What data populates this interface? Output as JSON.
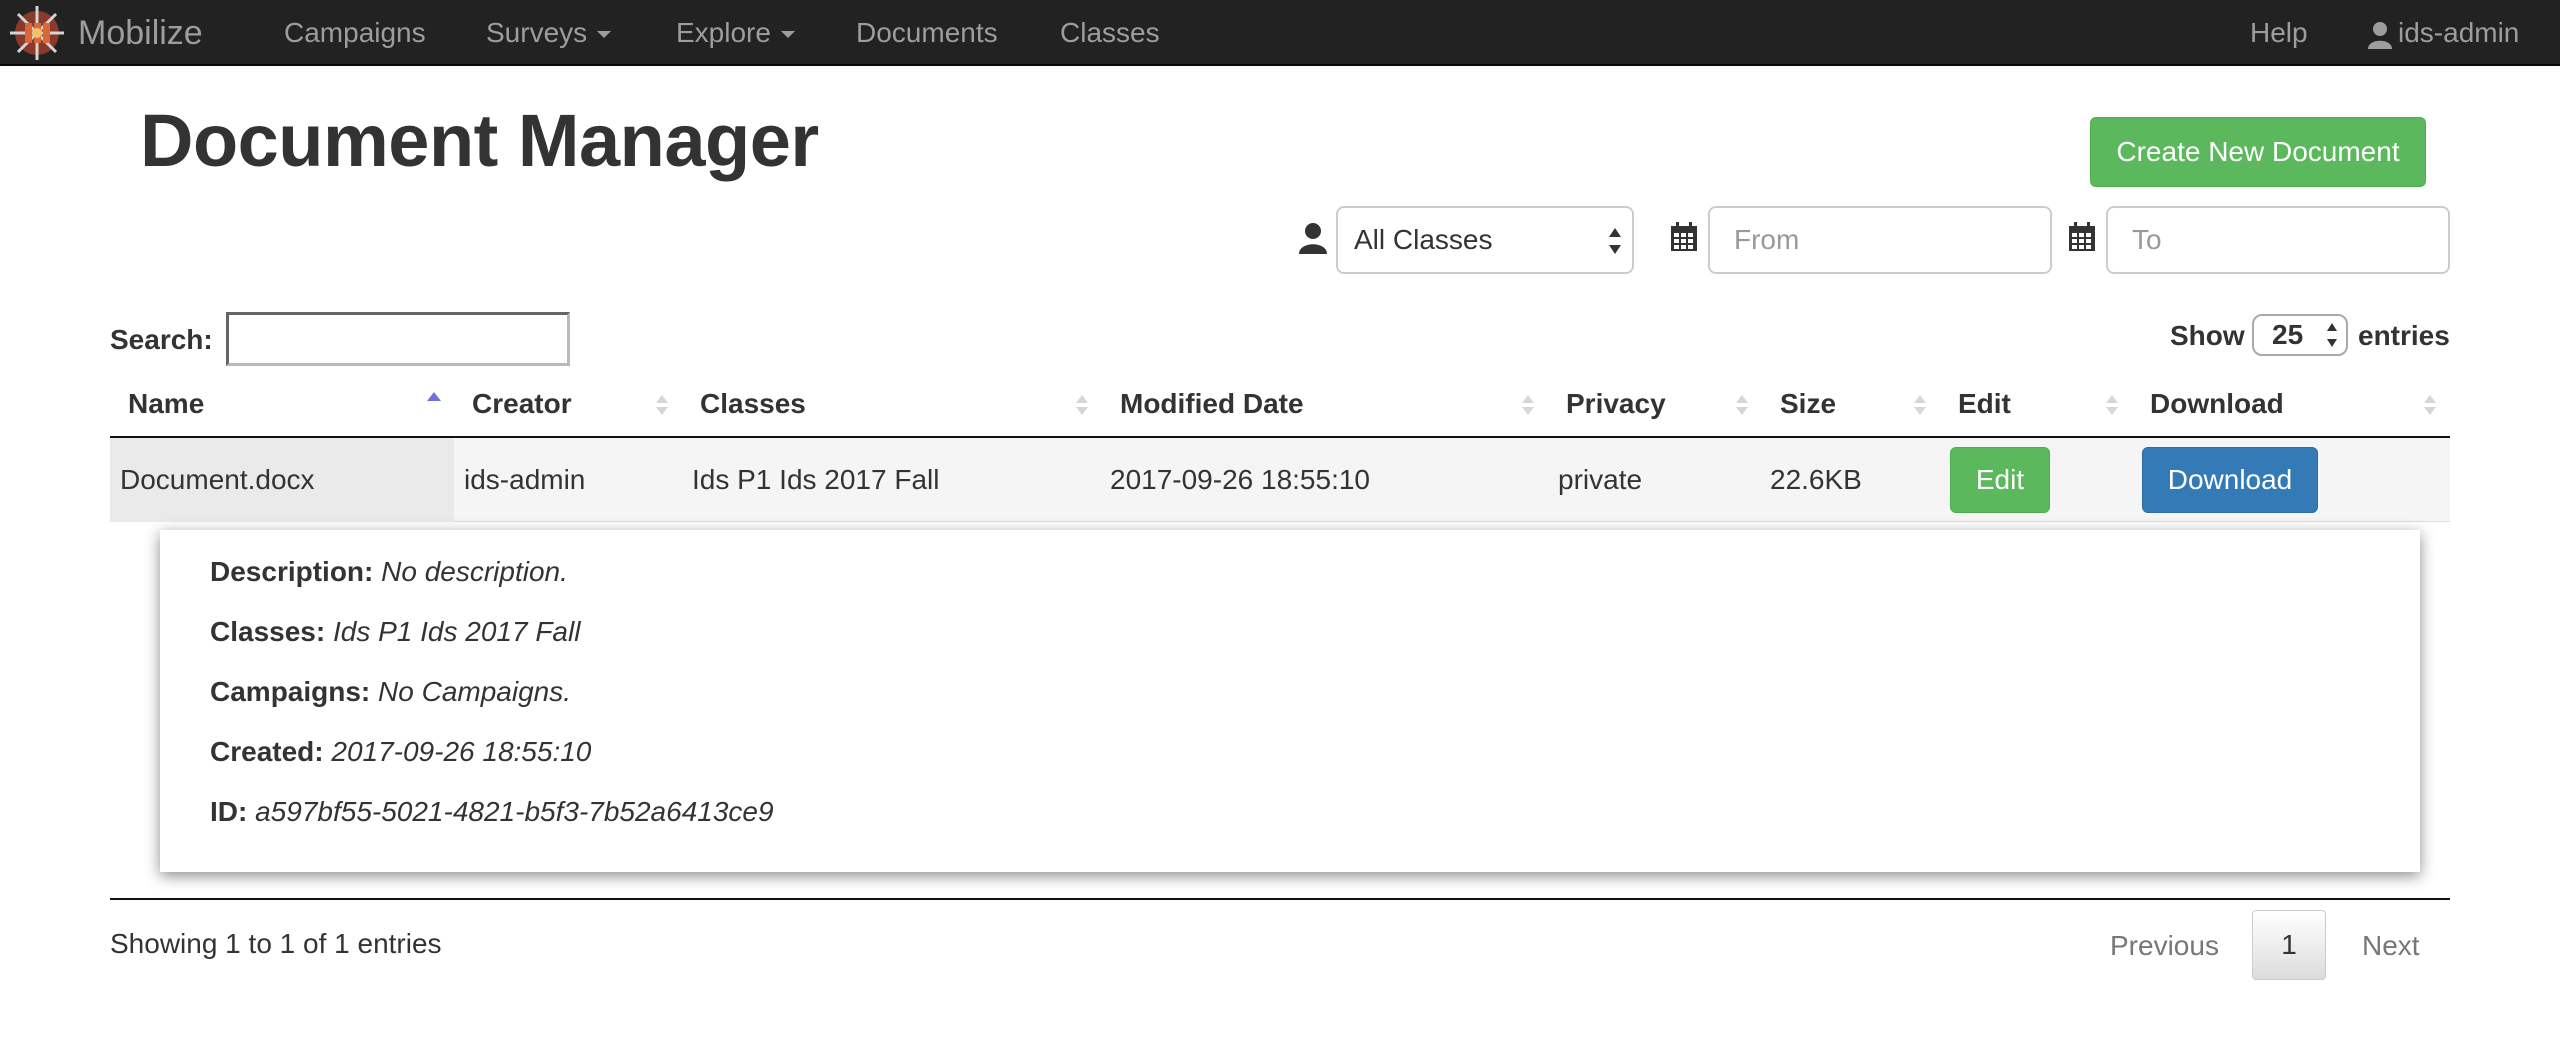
{
  "navbar": {
    "brand": "Mobilize",
    "items": [
      {
        "label": "Campaigns"
      },
      {
        "label": "Surveys"
      },
      {
        "label": "Explore"
      },
      {
        "label": "Documents"
      },
      {
        "label": "Classes"
      }
    ],
    "help": "Help",
    "user": "ids-admin"
  },
  "header": {
    "title": "Document Manager",
    "create_button": "Create New Document"
  },
  "filters": {
    "class_select": "All Classes",
    "from_placeholder": "From",
    "to_placeholder": "To"
  },
  "table_controls": {
    "search_label": "Search:",
    "search_value": "",
    "show_label": "Show",
    "show_value": "25",
    "entries_label": "entries"
  },
  "table": {
    "columns": [
      "Name",
      "Creator",
      "Classes",
      "Modified Date",
      "Privacy",
      "Size",
      "Edit",
      "Download"
    ],
    "rows": [
      {
        "name": "Document.docx",
        "creator": "ids-admin",
        "classes": "Ids P1 Ids 2017 Fall",
        "modified": "2017-09-26 18:55:10",
        "privacy": "private",
        "size": "22.6KB",
        "edit": "Edit",
        "download": "Download"
      }
    ]
  },
  "details": {
    "description_label": "Description:",
    "description": "No description.",
    "classes_label": "Classes:",
    "classes": "Ids P1 Ids 2017 Fall",
    "campaigns_label": "Campaigns:",
    "campaigns": "No Campaigns.",
    "created_label": "Created:",
    "created": "2017-09-26 18:55:10",
    "id_label": "ID:",
    "id": "a597bf55-5021-4821-b5f3-7b52a6413ce9"
  },
  "footer": {
    "info": "Showing 1 to 1 of 1 entries",
    "previous": "Previous",
    "page": "1",
    "next": "Next"
  },
  "colors": {
    "navbar": "#222222",
    "success": "#5cb85c",
    "primary": "#337ab7"
  }
}
